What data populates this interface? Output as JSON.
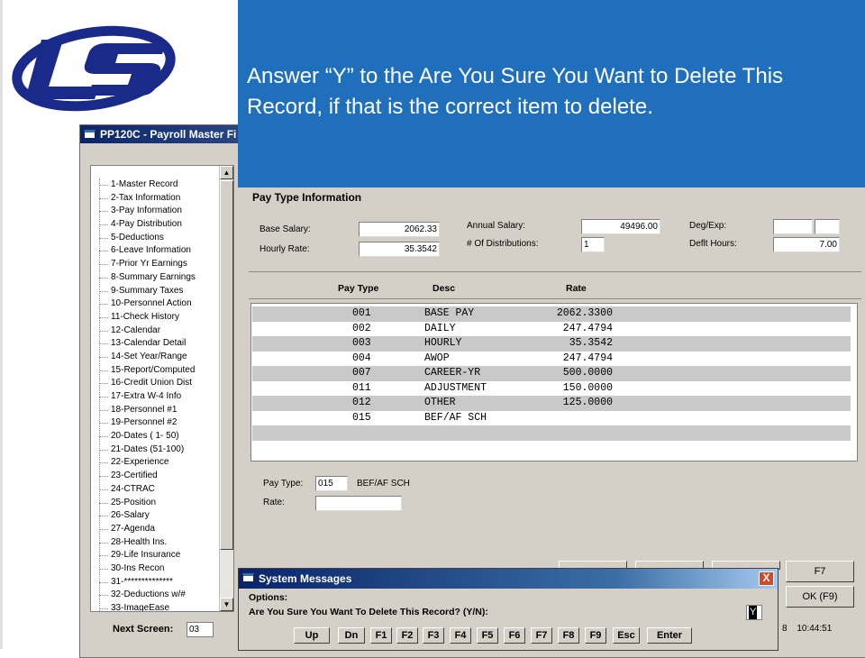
{
  "overlay": {
    "instruction": "Answer “Y” to the Are You Sure You Want to Delete This Record, if that is the correct item to delete."
  },
  "window": {
    "title": "PP120C - Payroll Master Fi"
  },
  "nav": {
    "items": [
      "1-Master Record",
      "2-Tax Information",
      "3-Pay Information",
      "4-Pay Distribution",
      "5-Deductions",
      "6-Leave Information",
      "7-Prior Yr Earnings",
      "8-Summary Earnings",
      "9-Summary Taxes",
      "10-Personnel Action",
      "11-Check History",
      "12-Calendar",
      "13-Calendar Detail",
      "14-Set Year/Range",
      "15-Report/Computed",
      "16-Credit Union Dist",
      "17-Extra W-4 Info",
      "18-Personnel #1",
      "19-Personnel #2",
      "20-Dates ( 1- 50)",
      "21-Dates (51-100)",
      "22-Experience",
      "23-Certified",
      "24-CTRAC",
      "25-Position",
      "26-Salary",
      "27-Agenda",
      "28-Health Ins.",
      "29-Life Insurance",
      "30-Ins Recon",
      "31-**************",
      "32-Deductions w/#",
      "33-ImageEase"
    ],
    "next_screen_label": "Next Screen:",
    "next_screen_value": "03"
  },
  "pay_info": {
    "section_title": "Pay Type Information",
    "base_salary_label": "Base Salary:",
    "base_salary_value": "2062.33",
    "hourly_rate_label": "Hourly Rate:",
    "hourly_rate_value": "35.3542",
    "annual_salary_label": "Annual Salary:",
    "annual_salary_value": "49496.00",
    "num_dist_label": "# Of Distributions:",
    "num_dist_value": "1",
    "deg_exp_label": "Deg/Exp:",
    "deflt_hours_label": "Deflt Hours:",
    "deflt_hours_value": "7.00"
  },
  "table": {
    "headers": {
      "pay_type": "Pay Type",
      "desc": "Desc",
      "rate": "Rate"
    },
    "rows": [
      {
        "code": "001",
        "desc": "BASE PAY",
        "rate": "2062.3300"
      },
      {
        "code": "002",
        "desc": "DAILY",
        "rate": "247.4794"
      },
      {
        "code": "003",
        "desc": "HOURLY",
        "rate": "35.3542"
      },
      {
        "code": "004",
        "desc": "AWOP",
        "rate": "247.4794"
      },
      {
        "code": "007",
        "desc": "CAREER-YR",
        "rate": "500.0000"
      },
      {
        "code": "011",
        "desc": "ADJUSTMENT",
        "rate": "150.0000"
      },
      {
        "code": "012",
        "desc": "OTHER",
        "rate": "125.0000"
      },
      {
        "code": "015",
        "desc": "BEF/AF SCH",
        "rate": ""
      }
    ]
  },
  "detail": {
    "pay_type_label": "Pay Type:",
    "pay_type_value": "015",
    "pay_type_desc": "BEF/AF SCH",
    "rate_label": "Rate:",
    "rate_value": ""
  },
  "buttons": {
    "f7": "F7",
    "ok": "OK (F9)"
  },
  "dialog": {
    "title": "System Messages",
    "close": "X",
    "options_label": "Options:",
    "question": "Are You Sure You Want To Delete This Record? (Y/N):",
    "answer": "Y",
    "keys": [
      "Up",
      "Dn",
      "F1",
      "F2",
      "F3",
      "F4",
      "F5",
      "F6",
      "F7",
      "F8",
      "F9",
      "Esc",
      "Enter"
    ]
  },
  "status": {
    "clock_prefix": "8",
    "time": "10:44:51"
  }
}
